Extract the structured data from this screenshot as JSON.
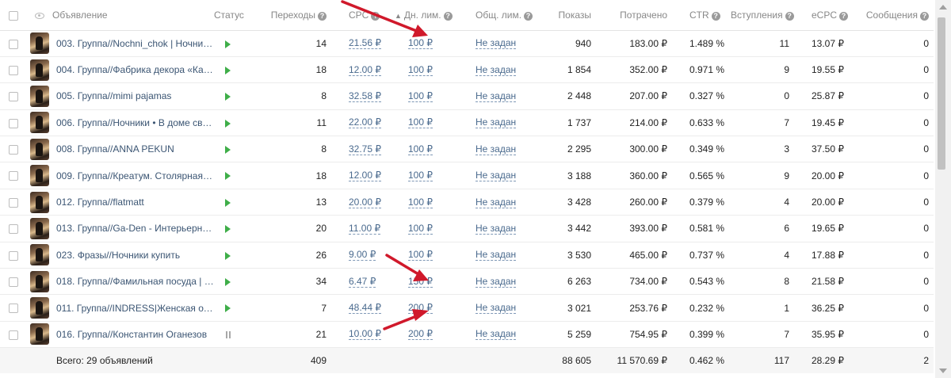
{
  "columns": {
    "ad": "Объявление",
    "status": "Статус",
    "clicks": "Переходы",
    "cpc": "CPC",
    "day_limit": "Дн. лим.",
    "total_limit": "Общ. лим.",
    "impressions": "Показы",
    "spent": "Потрачено",
    "ctr": "CTR",
    "joins": "Вступления",
    "ecpc": "eCPC",
    "messages": "Сообщения"
  },
  "help_glyph": "?",
  "sort_glyph": "▲",
  "rows": [
    {
      "name": "003. Группа//Nochni_chok | Ночник с...",
      "status": "play",
      "clicks": "14",
      "cpc": "21.56 ₽",
      "day_limit": "100 ₽",
      "total_limit": "Не задан",
      "impressions": "940",
      "spent": "183.00 ₽",
      "ctr": "1.489 %",
      "joins": "11",
      "ecpc": "13.07 ₽",
      "messages": "0"
    },
    {
      "name": "004. Группа//Фабрика декора «Камо...",
      "status": "play",
      "clicks": "18",
      "cpc": "12.00 ₽",
      "day_limit": "100 ₽",
      "total_limit": "Не задан",
      "impressions": "1 854",
      "spent": "352.00 ₽",
      "ctr": "0.971 %",
      "joins": "9",
      "ecpc": "19.55 ₽",
      "messages": "0"
    },
    {
      "name": "005. Группа//mimi pajamas",
      "status": "play",
      "clicks": "8",
      "cpc": "32.58 ₽",
      "day_limit": "100 ₽",
      "total_limit": "Не задан",
      "impressions": "2 448",
      "spent": "207.00 ₽",
      "ctr": "0.327 %",
      "joins": "0",
      "ecpc": "25.87 ₽",
      "messages": "0"
    },
    {
      "name": "006. Группа//Ночники • В доме светло",
      "status": "play",
      "clicks": "11",
      "cpc": "22.00 ₽",
      "day_limit": "100 ₽",
      "total_limit": "Не задан",
      "impressions": "1 737",
      "spent": "214.00 ₽",
      "ctr": "0.633 %",
      "joins": "7",
      "ecpc": "19.45 ₽",
      "messages": "0"
    },
    {
      "name": "008. Группа//ANNA PEKUN",
      "status": "play",
      "clicks": "8",
      "cpc": "32.75 ₽",
      "day_limit": "100 ₽",
      "total_limit": "Не задан",
      "impressions": "2 295",
      "spent": "300.00 ₽",
      "ctr": "0.349 %",
      "joins": "3",
      "ecpc": "37.50 ₽",
      "messages": "0"
    },
    {
      "name": "009. Группа//Креатум. Столярная м...",
      "status": "play",
      "clicks": "18",
      "cpc": "12.00 ₽",
      "day_limit": "100 ₽",
      "total_limit": "Не задан",
      "impressions": "3 188",
      "spent": "360.00 ₽",
      "ctr": "0.565 %",
      "joins": "9",
      "ecpc": "20.00 ₽",
      "messages": "0"
    },
    {
      "name": "012. Группа//flatmatt",
      "status": "play",
      "clicks": "13",
      "cpc": "20.00 ₽",
      "day_limit": "100 ₽",
      "total_limit": "Не задан",
      "impressions": "3 428",
      "spent": "260.00 ₽",
      "ctr": "0.379 %",
      "joins": "4",
      "ecpc": "20.00 ₽",
      "messages": "0"
    },
    {
      "name": "013. Группа//Ga-Den - Интерьерные...",
      "status": "play",
      "clicks": "20",
      "cpc": "11.00 ₽",
      "day_limit": "100 ₽",
      "total_limit": "Не задан",
      "impressions": "3 442",
      "spent": "393.00 ₽",
      "ctr": "0.581 %",
      "joins": "6",
      "ecpc": "19.65 ₽",
      "messages": "0"
    },
    {
      "name": "023. Фразы//Ночники купить",
      "status": "play",
      "clicks": "26",
      "cpc": "9.00 ₽",
      "day_limit": "100 ₽",
      "total_limit": "Не задан",
      "impressions": "3 530",
      "spent": "465.00 ₽",
      "ctr": "0.737 %",
      "joins": "4",
      "ecpc": "17.88 ₽",
      "messages": "0"
    },
    {
      "name": "018. Группа//Фамильная посуда | П...",
      "status": "play",
      "clicks": "34",
      "cpc": "6.47 ₽",
      "day_limit": "150 ₽",
      "total_limit": "Не задан",
      "impressions": "6 263",
      "spent": "734.00 ₽",
      "ctr": "0.543 %",
      "joins": "8",
      "ecpc": "21.58 ₽",
      "messages": "0"
    },
    {
      "name": "011. Группа//INDRESS|Женская оде...",
      "status": "play",
      "clicks": "7",
      "cpc": "48.44 ₽",
      "day_limit": "200 ₽",
      "total_limit": "Не задан",
      "impressions": "3 021",
      "spent": "253.76 ₽",
      "ctr": "0.232 %",
      "joins": "1",
      "ecpc": "36.25 ₽",
      "messages": "0"
    },
    {
      "name": "016. Группа//Константин Оганезов",
      "status": "pause",
      "clicks": "21",
      "cpc": "10.00 ₽",
      "day_limit": "200 ₽",
      "total_limit": "Не задан",
      "impressions": "5 259",
      "spent": "754.95 ₽",
      "ctr": "0.399 %",
      "joins": "7",
      "ecpc": "35.95 ₽",
      "messages": "0"
    }
  ],
  "totals": {
    "label": "Всего: 29 объявлений",
    "clicks": "409",
    "impressions": "88 605",
    "spent": "11 570.69 ₽",
    "ctr": "0.462 %",
    "joins": "117",
    "ecpc": "28.29 ₽",
    "messages": "2"
  },
  "colors": {
    "link": "#4a6a8e",
    "play": "#3fae49",
    "annotation_arrow": "#d0192b"
  },
  "icons": {
    "visibility": "eye-icon",
    "help": "help-icon",
    "status_active": "play-icon",
    "status_paused": "pause-icon"
  }
}
